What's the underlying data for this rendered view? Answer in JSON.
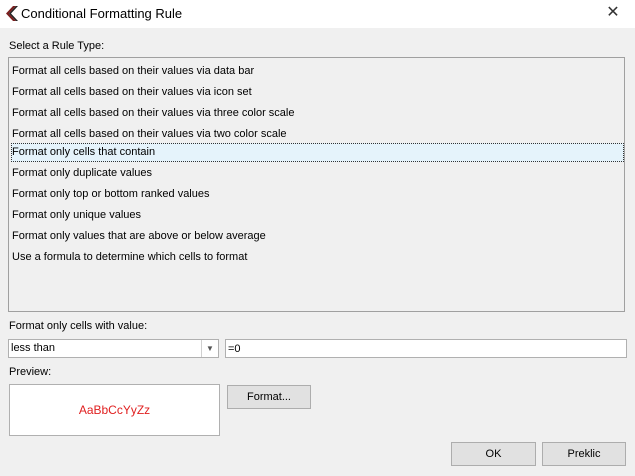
{
  "window": {
    "title": "Conditional Formatting Rule",
    "close_glyph": "✕"
  },
  "rule_type": {
    "label": "Select a Rule Type:",
    "items": [
      "Format all cells based on their values via data bar",
      "Format all cells based on their values via icon set",
      "Format all cells based on their values via three color scale",
      "Format all cells based on their values via two color scale",
      "Format only cells that contain",
      "Format only duplicate values",
      "Format only top or bottom ranked values",
      "Format only unique values",
      "Format only values that are above or below average",
      "Use a formula to determine which cells to format"
    ],
    "selected_index": 4
  },
  "condition": {
    "label": "Format only cells with value:",
    "operator": "less than",
    "value": "=0"
  },
  "preview": {
    "label": "Preview:",
    "sample_text": "AaBbCcYyZz",
    "sample_color": "#e02020"
  },
  "buttons": {
    "format": "Format...",
    "ok": "OK",
    "cancel": "Preklic"
  },
  "icons": {
    "app": "app-logo-icon",
    "combo_arrow": "chevron-down-icon",
    "close": "close-icon"
  }
}
